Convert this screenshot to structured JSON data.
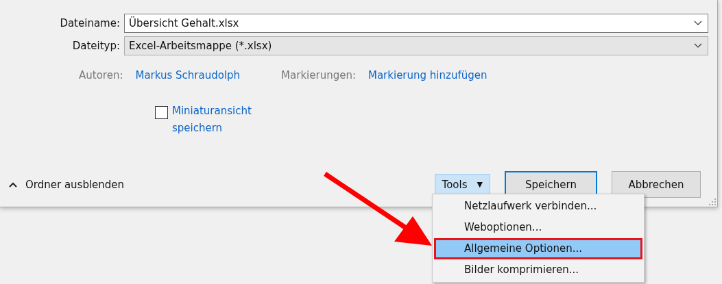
{
  "fields": [
    {
      "label": "Dateiname:",
      "value": "Übersicht Gehalt.xlsx",
      "editable": true
    },
    {
      "label": "Dateityp:",
      "value": "Excel-Arbeitsmappe (*.xlsx)",
      "editable": false
    }
  ],
  "meta": [
    {
      "label": "Autoren:",
      "value": "Markus Schraudolph"
    },
    {
      "label": "Markierungen:",
      "value": "Markierung hinzufügen"
    }
  ],
  "thumbnail": {
    "label": "Miniaturansicht speichern",
    "checked": false
  },
  "hide_folders": "Ordner ausblenden",
  "tools": {
    "label": "Tools",
    "caret": "▼",
    "open": true
  },
  "buttons": [
    {
      "label": "Speichern",
      "default": true
    },
    {
      "label": "Abbrechen",
      "default": false
    }
  ],
  "menu": [
    {
      "label": "Netzlaufwerk verbinden...",
      "selected": false
    },
    {
      "label": "Weboptionen...",
      "selected": false
    },
    {
      "label": "Allgemeine Optionen...",
      "selected": true
    },
    {
      "label": "Bilder komprimieren...",
      "selected": false
    }
  ]
}
